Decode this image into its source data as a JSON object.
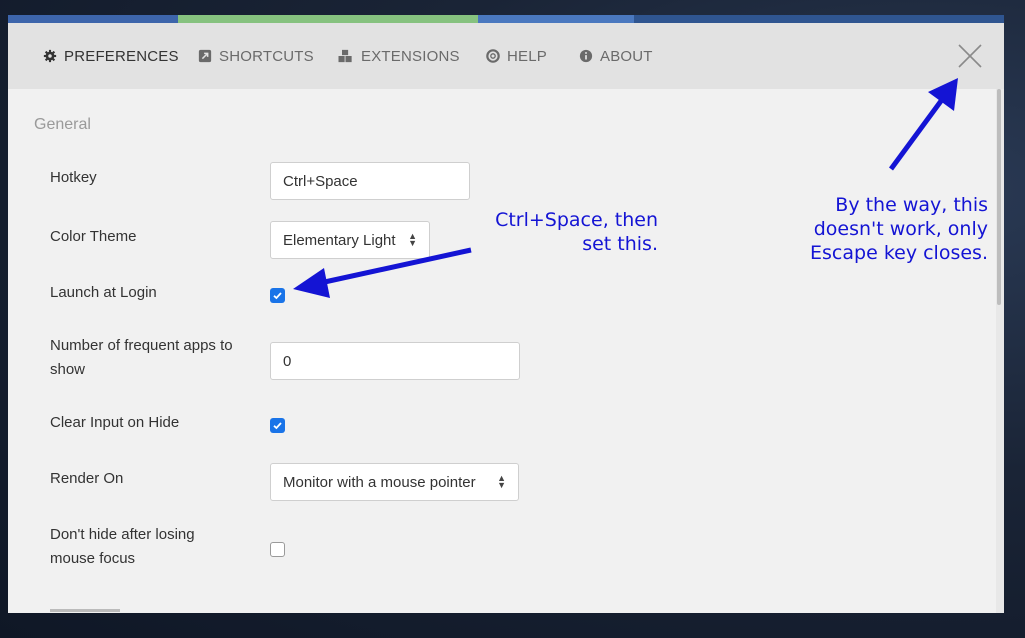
{
  "nav": {
    "items": [
      {
        "label": "PREFERENCES",
        "icon": "gear-icon",
        "active": true
      },
      {
        "label": "SHORTCUTS",
        "icon": "shortcut-icon",
        "active": false
      },
      {
        "label": "EXTENSIONS",
        "icon": "cubes-icon",
        "active": false
      },
      {
        "label": "HELP",
        "icon": "lifebuoy-icon",
        "active": false
      },
      {
        "label": "ABOUT",
        "icon": "info-icon",
        "active": false
      }
    ],
    "close_icon": "close-icon"
  },
  "section": {
    "title": "General"
  },
  "settings": {
    "hotkey": {
      "label": "Hotkey",
      "value": "Ctrl+Space"
    },
    "color_theme": {
      "label": "Color Theme",
      "value": "Elementary Light"
    },
    "launch_at_login": {
      "label": "Launch at Login",
      "checked": true
    },
    "frequent_apps": {
      "label_line1": "Number of frequent apps to",
      "label_line2": "show",
      "value": "0"
    },
    "clear_input": {
      "label": "Clear Input on Hide",
      "checked": true
    },
    "render_on": {
      "label": "Render On",
      "value": "Monitor with a mouse pointer"
    },
    "dont_hide": {
      "label_line1": "Don't hide after losing",
      "label_line2": "mouse focus",
      "checked": false
    }
  },
  "annotations": {
    "hotkey_note_line1": "Ctrl+Space, then",
    "hotkey_note_line2": "set this.",
    "close_note_line1": "By the way, this",
    "close_note_line2": "doesn't work, only",
    "close_note_line3": "Escape key closes."
  },
  "colors": {
    "accent": "#1a74e8",
    "annotation": "#1414d4",
    "strip": [
      "#3b63a8",
      "#7bbf7b",
      "#3b63a8",
      "#2c4f8a"
    ]
  }
}
